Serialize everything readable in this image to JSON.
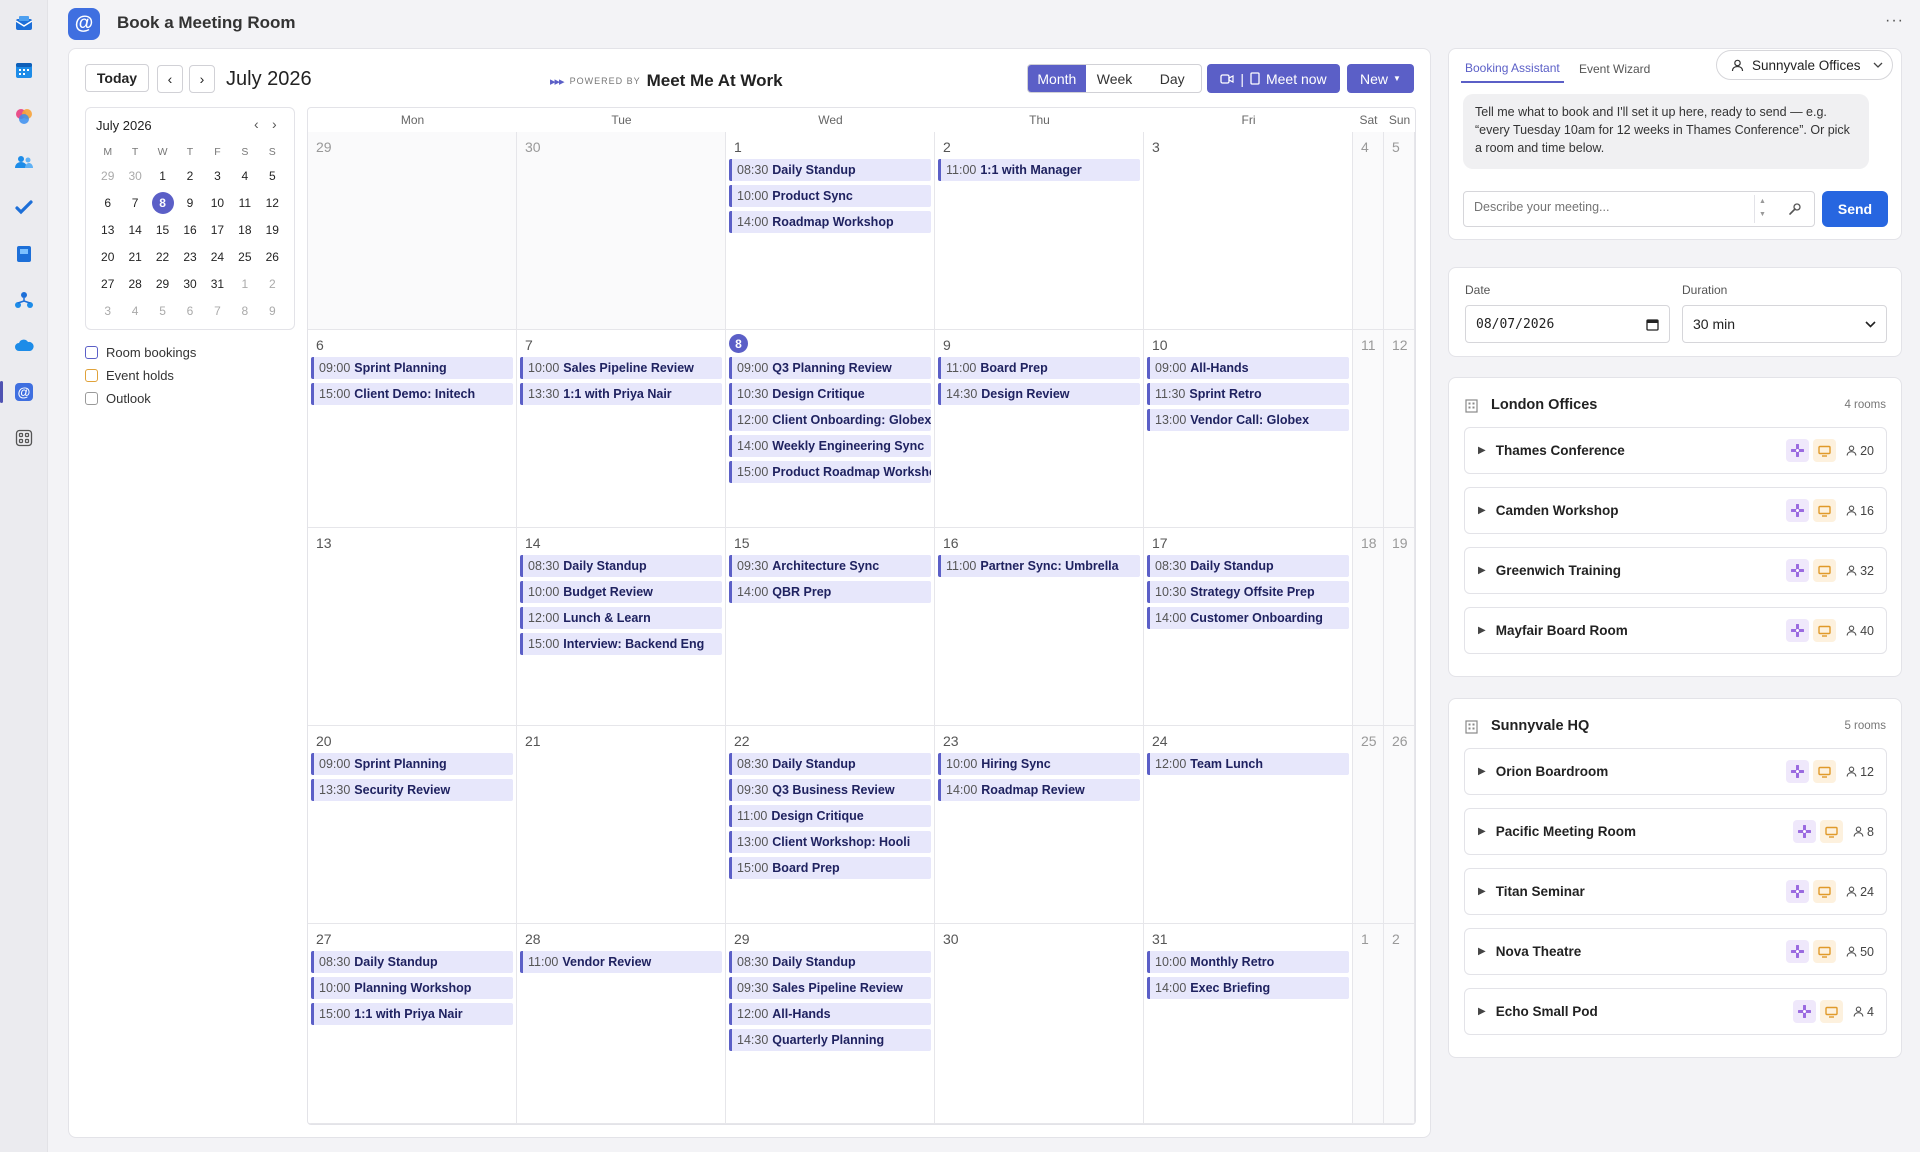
{
  "app": {
    "title": "Book a Meeting Room",
    "logo_glyph": "@",
    "more": "···"
  },
  "rail": [
    "mail-icon",
    "calendar-icon",
    "copilot-icon",
    "people-icon",
    "todo-icon",
    "bookings-icon",
    "org-icon",
    "onedrive-icon",
    "meetme-icon",
    "apps-icon"
  ],
  "toolbar": {
    "today": "Today",
    "prev": "‹",
    "next": "›",
    "month_title": "July 2026",
    "powered_arrows": "▸▸▸",
    "powered_by": "POWERED BY",
    "brand": "Meet Me At Work",
    "views": [
      "Month",
      "Week",
      "Day"
    ],
    "active_view": "Month",
    "meet_now": "Meet now",
    "meet_now_sep": "|",
    "new": "New"
  },
  "mini_calendar": {
    "title": "July 2026",
    "prev": "‹",
    "next": "›",
    "weekday_headers": [
      "M",
      "T",
      "W",
      "T",
      "F",
      "S",
      "S"
    ],
    "weeks": [
      [
        [
          "29",
          1
        ],
        [
          "30",
          1
        ],
        [
          "1",
          0
        ],
        [
          "2",
          0
        ],
        [
          "3",
          0
        ],
        [
          "4",
          0
        ],
        [
          "5",
          0
        ]
      ],
      [
        [
          "6",
          0
        ],
        [
          "7",
          0
        ],
        [
          "8",
          2
        ],
        [
          "9",
          0
        ],
        [
          "10",
          0
        ],
        [
          "11",
          0
        ],
        [
          "12",
          0
        ]
      ],
      [
        [
          "13",
          0
        ],
        [
          "14",
          0
        ],
        [
          "15",
          0
        ],
        [
          "16",
          0
        ],
        [
          "17",
          0
        ],
        [
          "18",
          0
        ],
        [
          "19",
          0
        ]
      ],
      [
        [
          "20",
          0
        ],
        [
          "21",
          0
        ],
        [
          "22",
          0
        ],
        [
          "23",
          0
        ],
        [
          "24",
          0
        ],
        [
          "25",
          0
        ],
        [
          "26",
          0
        ]
      ],
      [
        [
          "27",
          0
        ],
        [
          "28",
          0
        ],
        [
          "29",
          0
        ],
        [
          "30",
          0
        ],
        [
          "31",
          0
        ],
        [
          "1",
          1
        ],
        [
          "2",
          1
        ]
      ],
      [
        [
          "3",
          1
        ],
        [
          "4",
          1
        ],
        [
          "5",
          1
        ],
        [
          "6",
          1
        ],
        [
          "7",
          1
        ],
        [
          "8",
          1
        ],
        [
          "9",
          1
        ]
      ]
    ]
  },
  "legend": [
    {
      "label": "Room bookings",
      "color": "#5b5fc7"
    },
    {
      "label": "Event holds",
      "color": "#e0a23a"
    },
    {
      "label": "Outlook",
      "color": "#9a9a9a"
    }
  ],
  "calendar": {
    "headers": [
      "Mon",
      "Tue",
      "Wed",
      "Thu",
      "Fri",
      "Sat",
      "Sun"
    ],
    "weeks": [
      [
        {
          "d": "29",
          "other": true,
          "events": []
        },
        {
          "d": "30",
          "other": true,
          "events": []
        },
        {
          "d": "1",
          "events": [
            [
              "08:30",
              "Daily Standup"
            ],
            [
              "10:00",
              "Product Sync"
            ],
            [
              "14:00",
              "Roadmap Workshop"
            ]
          ]
        },
        {
          "d": "2",
          "events": [
            [
              "11:00",
              "1:1 with Manager"
            ]
          ]
        },
        {
          "d": "3",
          "events": []
        },
        {
          "d": "4",
          "events": []
        },
        {
          "d": "5",
          "events": []
        }
      ],
      [
        {
          "d": "6",
          "events": [
            [
              "09:00",
              "Sprint Planning"
            ],
            [
              "15:00",
              "Client Demo: Initech"
            ]
          ]
        },
        {
          "d": "7",
          "events": [
            [
              "10:00",
              "Sales Pipeline Review"
            ],
            [
              "13:30",
              "1:1 with Priya Nair"
            ]
          ]
        },
        {
          "d": "8",
          "today": true,
          "events": [
            [
              "09:00",
              "Q3 Planning Review"
            ],
            [
              "10:30",
              "Design Critique"
            ],
            [
              "12:00",
              "Client Onboarding: Globex"
            ],
            [
              "14:00",
              "Weekly Engineering Sync"
            ],
            [
              "15:00",
              "Product Roadmap Workshop"
            ]
          ]
        },
        {
          "d": "9",
          "events": [
            [
              "11:00",
              "Board Prep"
            ],
            [
              "14:30",
              "Design Review"
            ]
          ]
        },
        {
          "d": "10",
          "events": [
            [
              "09:00",
              "All-Hands"
            ],
            [
              "11:30",
              "Sprint Retro"
            ],
            [
              "13:00",
              "Vendor Call: Globex"
            ]
          ]
        },
        {
          "d": "11",
          "events": []
        },
        {
          "d": "12",
          "events": []
        }
      ],
      [
        {
          "d": "13",
          "events": []
        },
        {
          "d": "14",
          "events": [
            [
              "08:30",
              "Daily Standup"
            ],
            [
              "10:00",
              "Budget Review"
            ],
            [
              "12:00",
              "Lunch & Learn"
            ],
            [
              "15:00",
              "Interview: Backend Eng"
            ]
          ]
        },
        {
          "d": "15",
          "events": [
            [
              "09:30",
              "Architecture Sync"
            ],
            [
              "14:00",
              "QBR Prep"
            ]
          ]
        },
        {
          "d": "16",
          "events": [
            [
              "11:00",
              "Partner Sync: Umbrella"
            ]
          ]
        },
        {
          "d": "17",
          "events": [
            [
              "08:30",
              "Daily Standup"
            ],
            [
              "10:30",
              "Strategy Offsite Prep"
            ],
            [
              "14:00",
              "Customer Onboarding"
            ]
          ]
        },
        {
          "d": "18",
          "events": []
        },
        {
          "d": "19",
          "events": []
        }
      ],
      [
        {
          "d": "20",
          "events": [
            [
              "09:00",
              "Sprint Planning"
            ],
            [
              "13:30",
              "Security Review"
            ]
          ]
        },
        {
          "d": "21",
          "events": []
        },
        {
          "d": "22",
          "events": [
            [
              "08:30",
              "Daily Standup"
            ],
            [
              "09:30",
              "Q3 Business Review"
            ],
            [
              "11:00",
              "Design Critique"
            ],
            [
              "13:00",
              "Client Workshop: Hooli"
            ],
            [
              "15:00",
              "Board Prep"
            ]
          ]
        },
        {
          "d": "23",
          "events": [
            [
              "10:00",
              "Hiring Sync"
            ],
            [
              "14:00",
              "Roadmap Review"
            ]
          ]
        },
        {
          "d": "24",
          "events": [
            [
              "12:00",
              "Team Lunch"
            ]
          ]
        },
        {
          "d": "25",
          "events": []
        },
        {
          "d": "26",
          "events": []
        }
      ],
      [
        {
          "d": "27",
          "events": [
            [
              "08:30",
              "Daily Standup"
            ],
            [
              "10:00",
              "Planning Workshop"
            ],
            [
              "15:00",
              "1:1 with Priya Nair"
            ]
          ]
        },
        {
          "d": "28",
          "events": [
            [
              "11:00",
              "Vendor Review"
            ]
          ]
        },
        {
          "d": "29",
          "events": [
            [
              "08:30",
              "Daily Standup"
            ],
            [
              "09:30",
              "Sales Pipeline Review"
            ],
            [
              "12:00",
              "All-Hands"
            ],
            [
              "14:30",
              "Quarterly Planning"
            ]
          ]
        },
        {
          "d": "30",
          "events": []
        },
        {
          "d": "31",
          "events": [
            [
              "10:00",
              "Monthly Retro"
            ],
            [
              "14:00",
              "Exec Briefing"
            ]
          ]
        },
        {
          "d": "1",
          "other": true,
          "events": []
        },
        {
          "d": "2",
          "other": true,
          "events": []
        }
      ]
    ]
  },
  "assistant": {
    "tabs": [
      "Booking Assistant",
      "Event Wizard"
    ],
    "active_tab": "Booking Assistant",
    "location": "Sunnyvale Offices",
    "message": "Tell me what to book and I'll set it up here, ready to send — e.g. “every Tuesday 10am for 12 weeks in Thames Conference”. Or pick a room and time below.",
    "input_placeholder": "Describe your meeting...",
    "send": "Send"
  },
  "booking_form": {
    "date_label": "Date",
    "date_value": "08/07/2026",
    "duration_label": "Duration",
    "duration_value": "30 min"
  },
  "room_groups": [
    {
      "name": "London Offices",
      "count": "4 rooms",
      "rooms": [
        {
          "name": "Thames Conference",
          "capacity": "20"
        },
        {
          "name": "Camden Workshop",
          "capacity": "16"
        },
        {
          "name": "Greenwich Training",
          "capacity": "32"
        },
        {
          "name": "Mayfair Board Room",
          "capacity": "40"
        }
      ]
    },
    {
      "name": "Sunnyvale HQ",
      "count": "5 rooms",
      "rooms": [
        {
          "name": "Orion Boardroom",
          "capacity": "12"
        },
        {
          "name": "Pacific Meeting Room",
          "capacity": "8"
        },
        {
          "name": "Titan Seminar",
          "capacity": "24"
        },
        {
          "name": "Nova Theatre",
          "capacity": "50"
        },
        {
          "name": "Echo Small Pod",
          "capacity": "4"
        }
      ]
    }
  ],
  "colors": {
    "accent": "#5b5fc7",
    "send": "#2766e0",
    "event_bg": "#e7e7fb"
  }
}
